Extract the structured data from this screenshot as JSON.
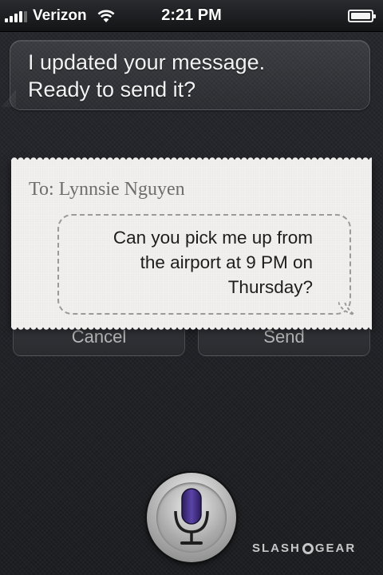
{
  "status_bar": {
    "carrier": "Verizon",
    "time": "2:21 PM",
    "signal_bars": 4,
    "battery_level": 1.0,
    "icons": [
      "signal-icon",
      "wifi-icon",
      "battery-icon"
    ]
  },
  "siri": {
    "response": "I updated your message.\nReady to send it?"
  },
  "message": {
    "to_label": "To: Lynnsie Nguyen",
    "body": "Can you pick me up from\nthe airport at 9 PM on\nThursday?"
  },
  "actions": {
    "cancel_label": "Cancel",
    "send_label": "Send"
  },
  "mic": {
    "icon": "microphone-icon",
    "accent_color": "#3d2a7a"
  },
  "watermark": {
    "left": "SLASH",
    "right": "GEAR"
  }
}
